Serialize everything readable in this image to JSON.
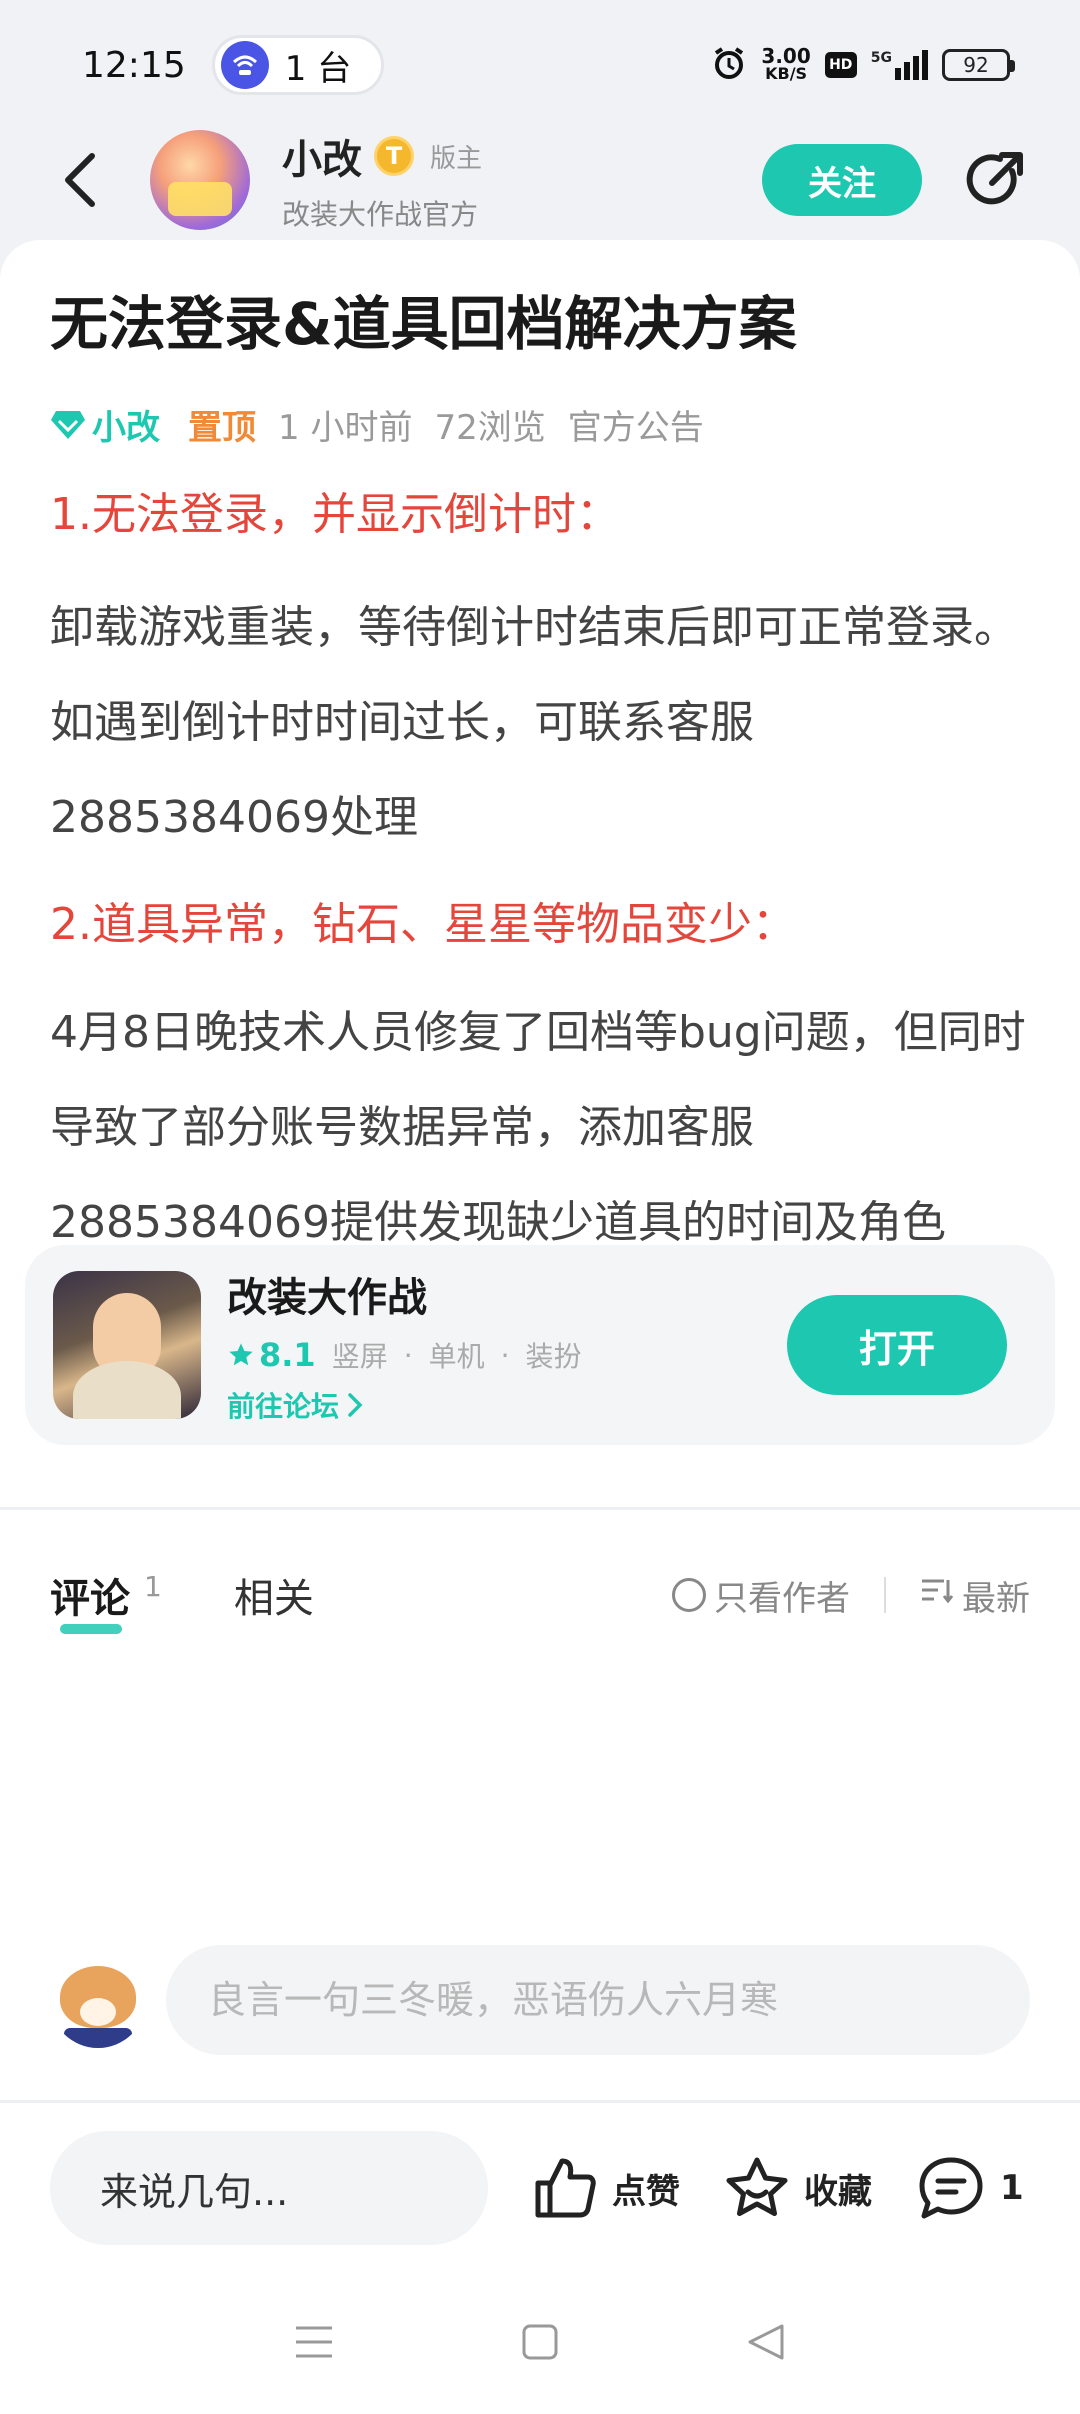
{
  "status_bar": {
    "time": "12:15",
    "device_count": "1 台",
    "net_speed_value": "3.00",
    "net_speed_unit": "KB/S",
    "hd": "HD",
    "network": "5G",
    "battery": "92"
  },
  "header": {
    "author_name": "小改",
    "level_badge": "T",
    "role": "版主",
    "author_subtitle": "改装大作战官方",
    "follow_label": "关注"
  },
  "post": {
    "title": "无法登录&道具回档解决方案",
    "meta": {
      "author": "小改",
      "pinned": "置顶",
      "time": "1 小时前",
      "views": "72浏览",
      "category": "官方公告"
    },
    "section1_heading": "1.无法登录，并显示倒计时：",
    "section1_body": "卸载游戏重装，等待倒计时结束后即可正常登录。如遇到倒计时时间过长，可联系客服2885384069处理",
    "section2_heading": "2.道具异常，钻石、星星等物品变少：",
    "section2_body": "4月8日晚技术人员修复了回档等bug问题，但同时导致了部分账号数据异常，添加客服2885384069提供发现缺少道具的时间及角色ID，修复完成后会为补发损失的物品以及额外的补偿礼包"
  },
  "game_card": {
    "name": "改装大作战",
    "score": "8.1",
    "tags": [
      "竖屏",
      "单机",
      "装扮"
    ],
    "tag_sep": "·",
    "forum_link": "前往论坛",
    "open_label": "打开"
  },
  "comments": {
    "tab_comments": "评论",
    "comment_count": "1",
    "tab_related": "相关",
    "only_author": "只看作者",
    "sort_label": "最新",
    "input_placeholder": "良言一句三冬暖，恶语伤人六月寒"
  },
  "action_bar": {
    "reply_placeholder": "来说几句...",
    "like_label": "点赞",
    "favorite_label": "收藏",
    "comment_count": "1"
  },
  "colors": {
    "accent": "#1ec8b0",
    "heading_red": "#e5463c",
    "pinned_orange": "#f08a37"
  }
}
